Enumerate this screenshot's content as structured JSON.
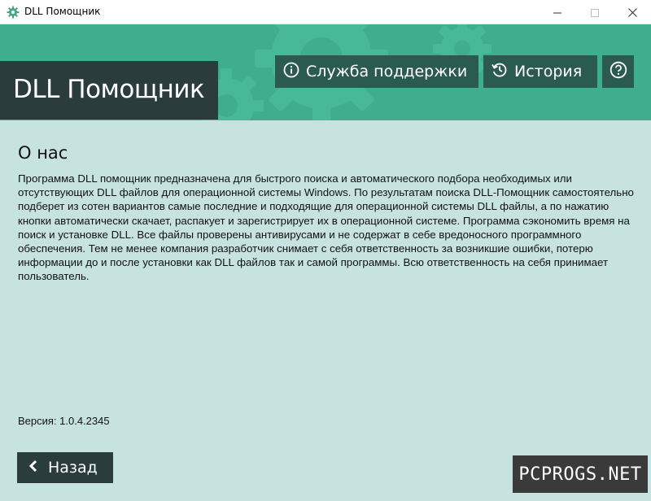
{
  "window": {
    "title": "DLL Помощник",
    "icon": "gear-icon",
    "controls": [
      "minimize-icon",
      "maximize-icon",
      "close-icon"
    ]
  },
  "header": {
    "brand": "DLL Помощник",
    "support_label": "Служба поддержки",
    "support_icon": "info-icon",
    "history_label": "История",
    "history_icon": "history-icon",
    "help_icon": "help-icon"
  },
  "content": {
    "title": "О нас",
    "description": "Программа DLL помощник предназначена для быстрого поиска и автоматического подбора необходимых или отсутствующих DLL файлов для операционной системы Windows. По результатам поиска DLL-Помощник самостоятельно подберет из сотен вариантов самые последние и подходящие для операционной системы DLL файлы, а по нажатию кнопки автоматически скачает, распакует и зарегистрирует их в операционной системе. Программа сэкономить время на поиск и установке DLL. Все файлы проверены антивирусами и не содержат в себе вредоносного программного обеспечения. Тем не менее компания разработчик снимает с себя ответственность за возникшие ошибки, потерю информации до и после установки как DLL файлов так и самой программы. Всю ответственность на себя принимает пользователь.",
    "version": "Версия: 1.0.4.2345"
  },
  "footer": {
    "back_label": "Назад",
    "back_icon": "chevron-left-icon",
    "watermark": "PCPROGS.NET"
  },
  "colors": {
    "background": "#c7e3e0",
    "header_green": "#3fae8f",
    "brand_dark": "#2b3c3c",
    "button_dark_green": "#2b5a50",
    "app_icon_green": "#3ea883"
  }
}
